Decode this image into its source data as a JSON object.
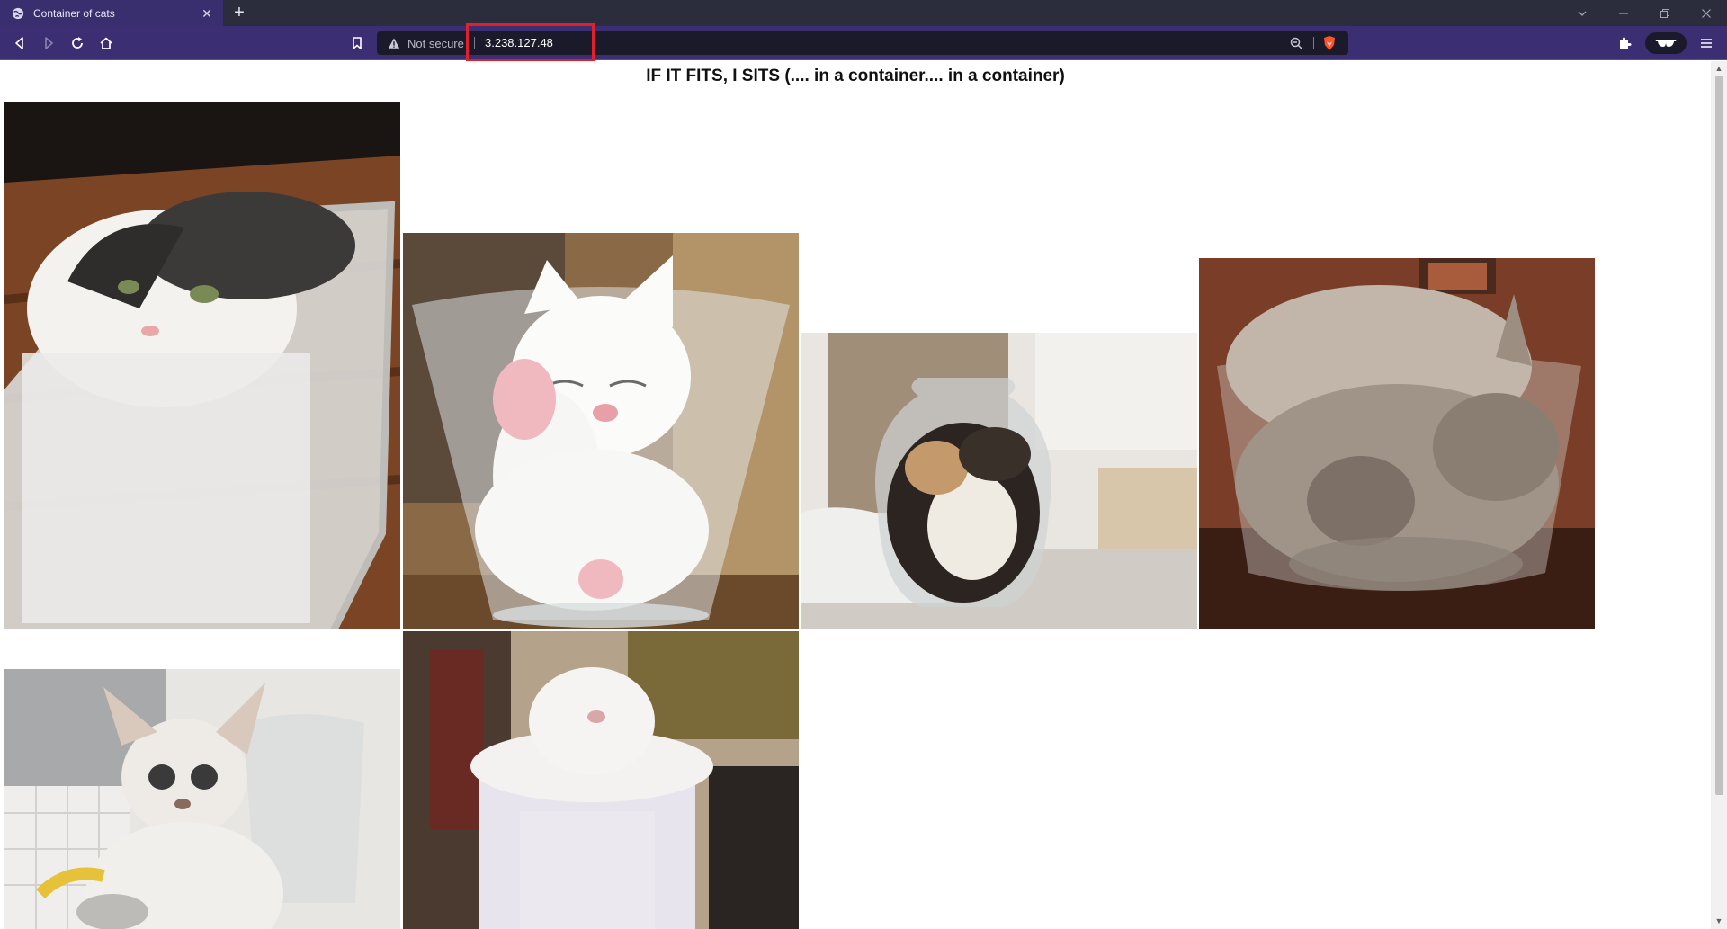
{
  "browser": {
    "tab_title": "Container of cats",
    "security_label": "Not secure",
    "url": "3.238.127.48"
  },
  "page": {
    "heading": "IF IT FITS, I SITS (.... in a container.... in a container)"
  },
  "images": [
    {
      "name": "cat-in-plastic-box",
      "alt": "kitten in a translucent plastic box"
    },
    {
      "name": "cat-in-glass-bowl",
      "alt": "white cat sleeping in a glass bowl"
    },
    {
      "name": "cat-in-glass-jar",
      "alt": "calico cat curled in a glass jar"
    },
    {
      "name": "cat-in-large-bowl",
      "alt": "siamese cat curled in a large glass bowl"
    },
    {
      "name": "cat-with-vase",
      "alt": "kitten beside a glass vase"
    },
    {
      "name": "cat-in-bin",
      "alt": "white cat stuffed in a bin"
    }
  ],
  "colors": {
    "tab_bg": "#3a2f6e",
    "toolbar_bg": "#3b2e72",
    "highlight": "#e0212c"
  }
}
